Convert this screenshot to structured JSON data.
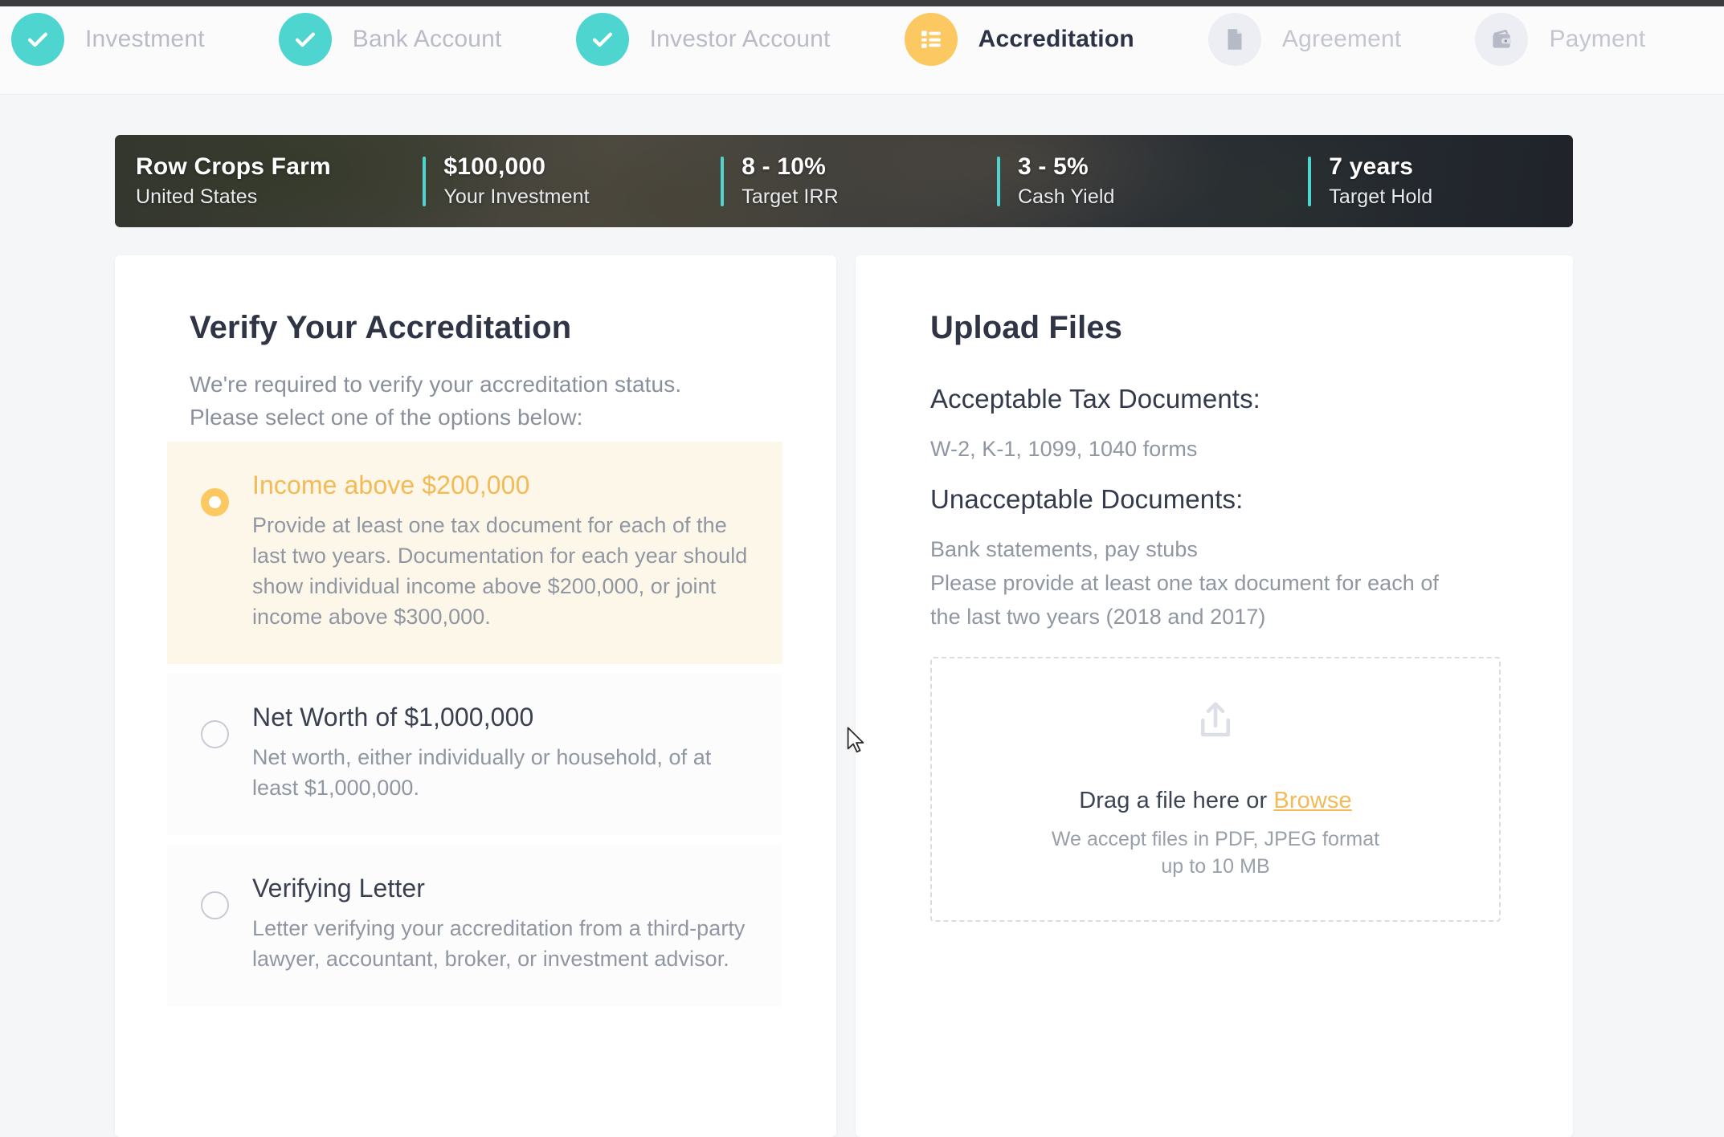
{
  "stepper": {
    "steps": [
      {
        "label": "Investment",
        "icon": "check-icon",
        "state": "done"
      },
      {
        "label": "Bank Account",
        "icon": "check-icon",
        "state": "done"
      },
      {
        "label": "Investor Account",
        "icon": "check-icon",
        "state": "done"
      },
      {
        "label": "Accreditation",
        "icon": "list-icon",
        "state": "active"
      },
      {
        "label": "Agreement",
        "icon": "document-icon",
        "state": "todo"
      },
      {
        "label": "Payment",
        "icon": "wallet-icon",
        "state": "todo"
      }
    ]
  },
  "hero": {
    "cells": [
      {
        "value": "Row Crops Farm",
        "caption": "United States"
      },
      {
        "value": "$100,000",
        "caption": "Your Investment"
      },
      {
        "value": "8 - 10%",
        "caption": "Target IRR"
      },
      {
        "value": "3 - 5%",
        "caption": "Cash Yield"
      },
      {
        "value": "7 years",
        "caption": "Target Hold"
      }
    ]
  },
  "accreditation": {
    "title": "Verify Your Accreditation",
    "subtitle_line1": "We're required to verify your accreditation status.",
    "subtitle_line2": "Please select one of the options below:",
    "options": [
      {
        "title": "Income above $200,000",
        "description": "Provide at least one tax document for each of the last two years. Documentation for each year should show individual income above $200,000, or joint income above $300,000.",
        "selected": true
      },
      {
        "title": "Net Worth of $1,000,000",
        "description": "Net worth, either individually or household, of at least $1,000,000.",
        "selected": false
      },
      {
        "title": "Verifying Letter",
        "description": "Letter verifying your accreditation from a third-party lawyer, accountant, broker, or investment advisor.",
        "selected": false
      }
    ]
  },
  "upload": {
    "title": "Upload Files",
    "acceptable_heading": "Acceptable Tax Documents:",
    "acceptable_body": "W-2, K-1, 1099, 1040 forms",
    "unacceptable_heading": "Unacceptable Documents:",
    "unacceptable_line1": "Bank statements, pay stubs",
    "unacceptable_line2": "Please provide at least one tax document for each of",
    "unacceptable_line3": "the last two years (2018 and 2017)",
    "dropzone": {
      "icon": "upload-icon",
      "prompt_prefix": "Drag a file here or ",
      "browse_label": "Browse",
      "hint_line1": "We accept files in PDF, JPEG format",
      "hint_line2": "up to 10 MB"
    }
  },
  "colors": {
    "accent_orange": "#fbc862",
    "accent_teal": "#4fd5cf",
    "page_background": "#f5f6f8",
    "card_background": "#ffffff",
    "selected_option_background": "#fdf7e9"
  }
}
